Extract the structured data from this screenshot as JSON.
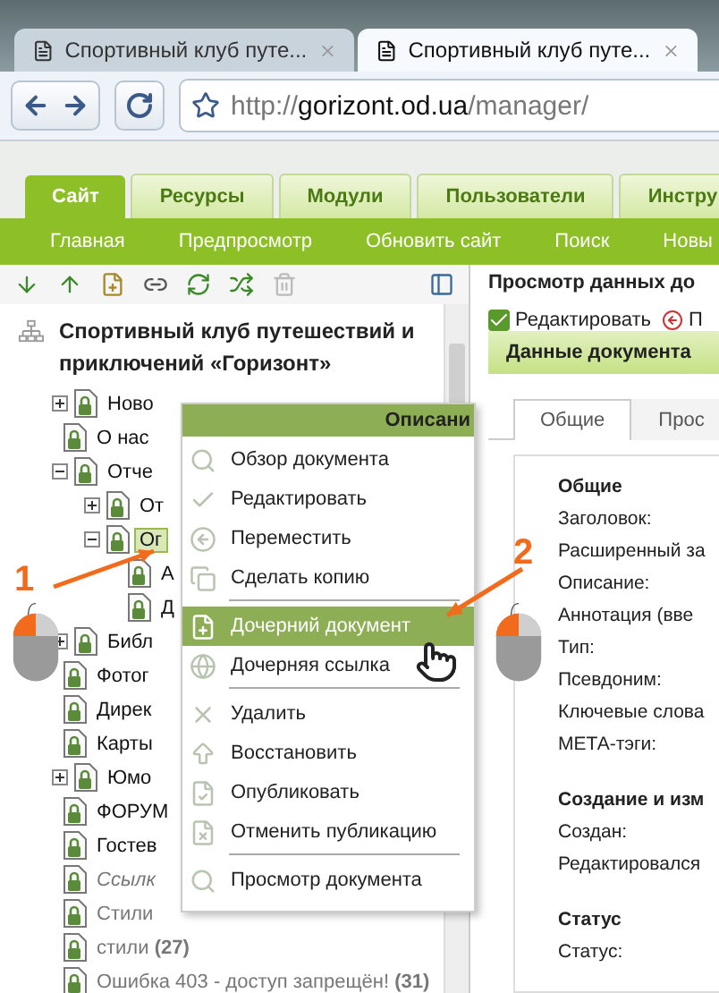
{
  "browser": {
    "tabs": [
      {
        "title": "Спортивный клуб путе...",
        "selected": false
      },
      {
        "title": "Спортивный клуб путе...",
        "selected": true
      }
    ],
    "address": {
      "scheme": "http://",
      "host": "gorizont.od.ua",
      "path": "/manager/"
    }
  },
  "main_tabs": [
    {
      "label": "Сайт",
      "selected": true
    },
    {
      "label": "Ресурсы",
      "selected": false
    },
    {
      "label": "Модули",
      "selected": false
    },
    {
      "label": "Пользователи",
      "selected": false
    },
    {
      "label": "Инстру",
      "selected": false
    }
  ],
  "sub_nav": [
    "Главная",
    "Предпросмотр",
    "Обновить сайт",
    "Поиск",
    "Новы"
  ],
  "tree": {
    "root": "Спортивный клуб путешествий и приключений «Горизонт»",
    "items": [
      {
        "label": "Ново",
        "kind": "folder",
        "expanded": false,
        "selected": false,
        "published": true,
        "hidden": false
      },
      {
        "label": "О нас",
        "kind": "page",
        "selected": false,
        "published": true,
        "hidden": false
      },
      {
        "label": "Отче",
        "kind": "folder",
        "expanded": true,
        "selected": false,
        "published": true,
        "hidden": false,
        "children": [
          {
            "label": "От",
            "kind": "folder",
            "expanded": false,
            "selected": false,
            "published": true,
            "hidden": false
          },
          {
            "label": "Ог",
            "kind": "folder",
            "expanded": true,
            "selected": true,
            "published": true,
            "hidden": false,
            "children": [
              {
                "label": "А",
                "kind": "page",
                "selected": false,
                "published": true,
                "hidden": false
              },
              {
                "label": "Д",
                "kind": "page",
                "selected": false,
                "published": true,
                "hidden": false
              }
            ]
          }
        ]
      },
      {
        "label": "Библ",
        "kind": "folder",
        "expanded": false,
        "selected": false,
        "published": true,
        "hidden": false
      },
      {
        "label": "Фотог",
        "kind": "page",
        "selected": false,
        "published": true,
        "hidden": false
      },
      {
        "label": "Дирек",
        "kind": "page",
        "selected": false,
        "published": true,
        "hidden": false
      },
      {
        "label": "Карты",
        "kind": "page",
        "selected": false,
        "published": true,
        "hidden": false
      },
      {
        "label": "Юмо",
        "kind": "folder",
        "expanded": false,
        "selected": false,
        "published": true,
        "hidden": false
      },
      {
        "label": "ФОРУМ",
        "kind": "page",
        "selected": false,
        "published": true,
        "hidden": false
      },
      {
        "label": "Гостев",
        "kind": "page",
        "selected": false,
        "published": true,
        "hidden": false
      },
      {
        "label": "Ссылк",
        "kind": "page",
        "selected": false,
        "published": false,
        "hidden": true
      },
      {
        "label": "Стили",
        "kind": "page",
        "selected": false,
        "published": false,
        "hidden": false
      },
      {
        "label": "стили **(27)**",
        "kind": "page",
        "selected": false,
        "published": false,
        "hidden": false
      },
      {
        "label": "Ошибка 403 - доступ запрещён! **(31)**",
        "kind": "page",
        "selected": false,
        "published": false,
        "hidden": false
      }
    ]
  },
  "context_menu": {
    "title": "Описани",
    "groups": [
      [
        {
          "label": "Обзор документа",
          "selected": false
        },
        {
          "label": "Редактировать",
          "selected": false
        },
        {
          "label": "Переместить",
          "selected": false
        },
        {
          "label": "Сделать копию",
          "selected": false
        }
      ],
      [
        {
          "label": "Дочерний документ",
          "selected": true
        },
        {
          "label": "Дочерняя ссылка",
          "selected": false
        }
      ],
      [
        {
          "label": "Удалить",
          "selected": false
        },
        {
          "label": "Восстановить",
          "selected": false
        },
        {
          "label": "Опубликовать",
          "selected": false
        },
        {
          "label": "Отменить публикацию",
          "selected": false
        }
      ],
      [
        {
          "label": "Просмотр документа",
          "selected": false
        }
      ]
    ]
  },
  "document": {
    "title": "Просмотр данных до",
    "actions": [
      "Редактировать",
      "П"
    ],
    "panel_title": "Данные документа",
    "tabs": [
      {
        "label": "Общие",
        "selected": true
      },
      {
        "label": "Прос",
        "selected": false
      }
    ],
    "sections": [
      {
        "heading": "Общие",
        "fields": [
          "Заголовок:",
          "Расширенный за",
          "Описание:",
          "Аннотация (вве",
          "Тип:",
          "Псевдоним:",
          "Ключевые слова",
          "МЕТА-тэги:"
        ]
      },
      {
        "heading": "Создание и изм",
        "fields": [
          "Создан:",
          "Редактировался"
        ]
      },
      {
        "heading": "Статус",
        "fields": [
          "Статус:"
        ]
      }
    ]
  },
  "callouts": [
    "1",
    "2"
  ]
}
